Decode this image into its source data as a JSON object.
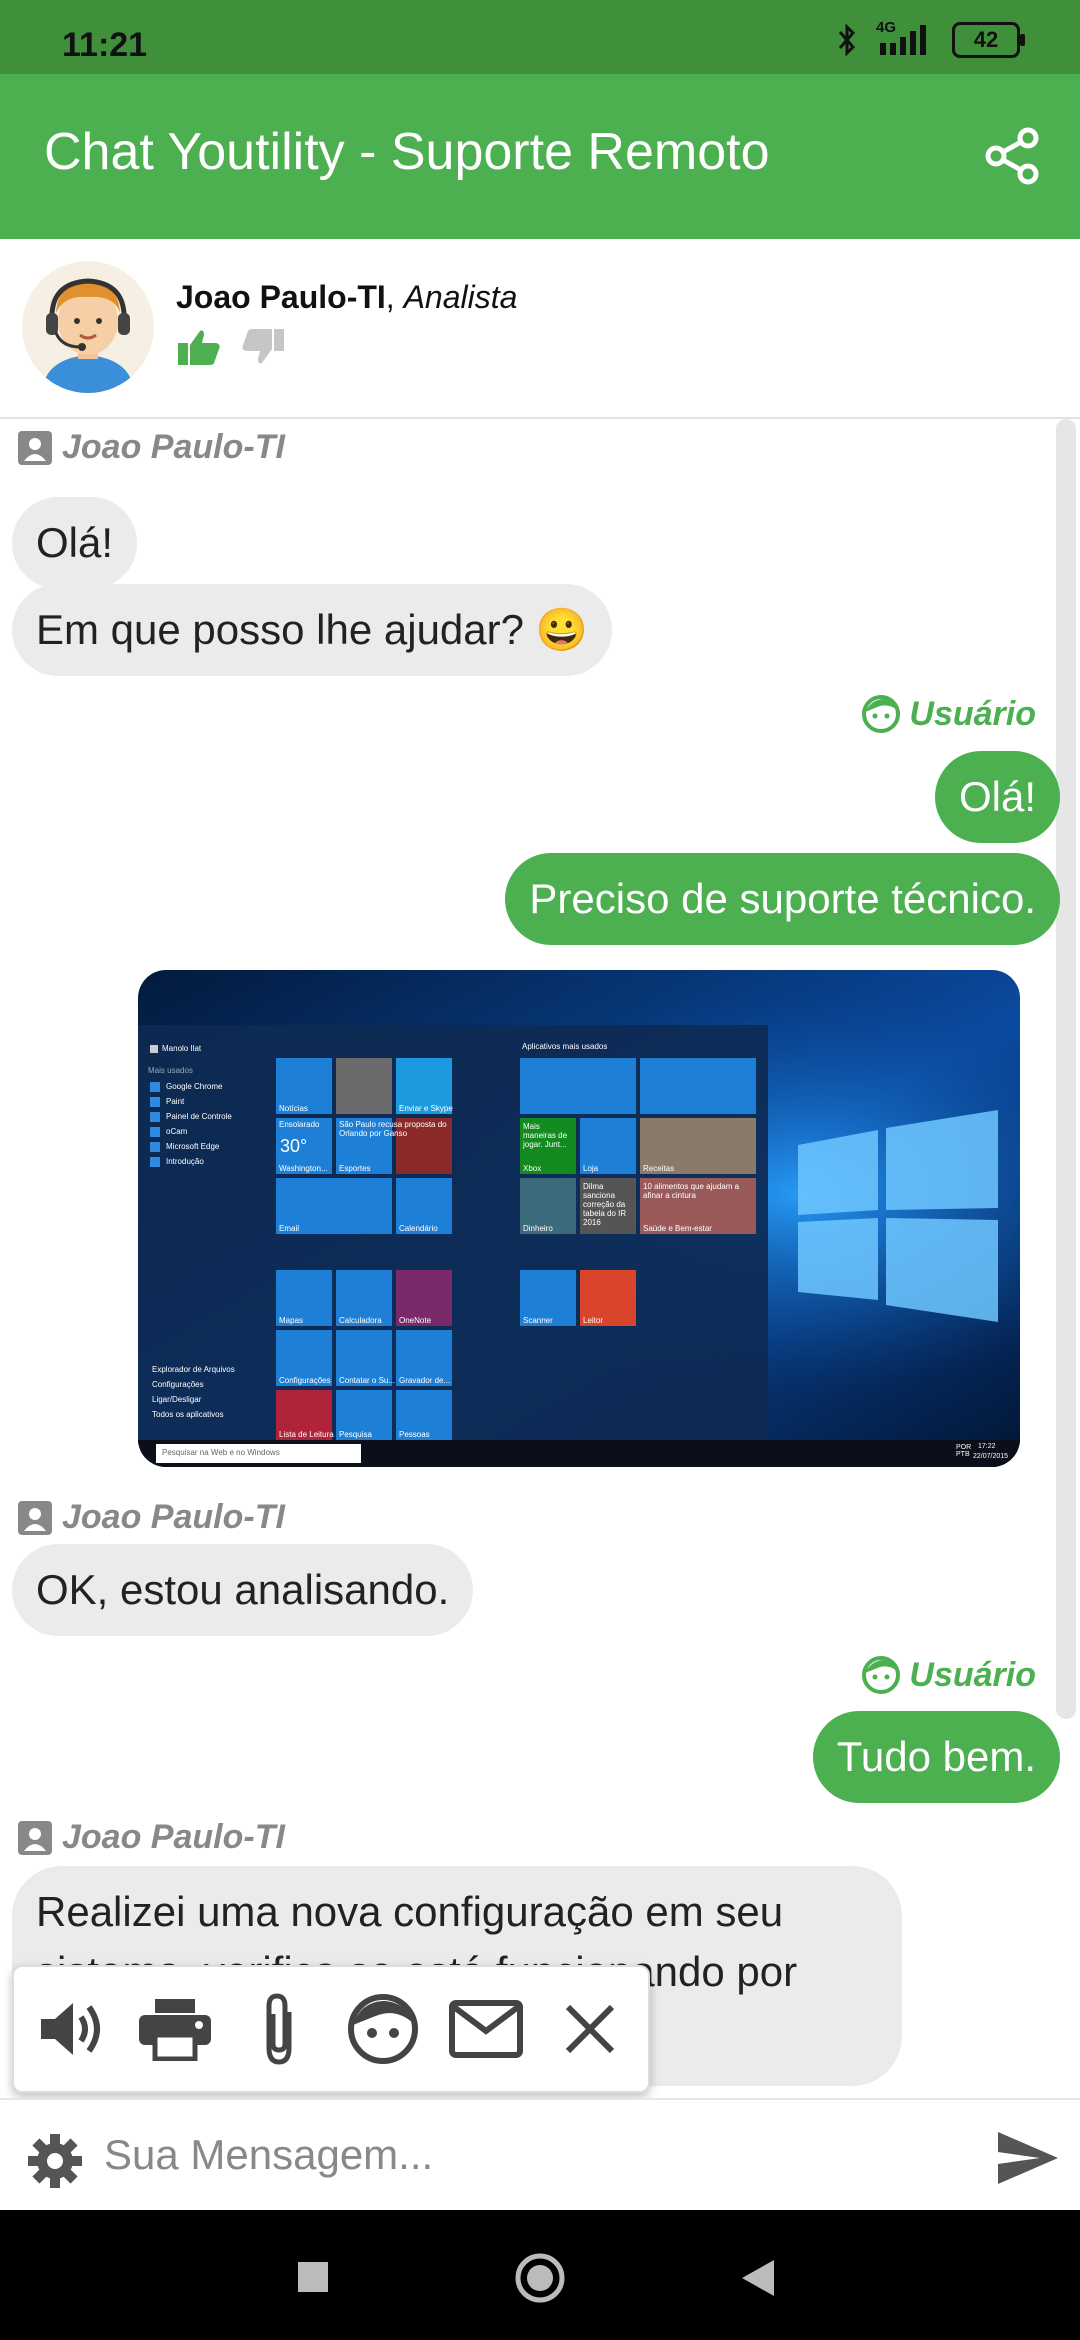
{
  "status_bar": {
    "time": "11:21",
    "network": "4G",
    "battery": "42"
  },
  "app_bar": {
    "title": "Chat Youtility - Suporte Remoto",
    "share_icon": "share-icon"
  },
  "agent": {
    "name": "Joao Paulo-TI",
    "separator": ", ",
    "role": "Analista",
    "like_icon": "thumbs-up-icon",
    "dislike_icon": "thumbs-down-icon"
  },
  "messages": {
    "agent_sender_1": "Joao Paulo-TI",
    "agent_msg_1": "Olá!",
    "agent_msg_2": "Em que posso lhe ajudar? 😀",
    "user_sender_1": "Usuário",
    "user_msg_1": "Olá!",
    "user_msg_2": "Preciso de suporte técnico.",
    "agent_sender_2": "Joao Paulo-TI",
    "agent_msg_3": "OK, estou analisando.",
    "user_sender_2": "Usuário",
    "user_msg_3": "Tudo bem.",
    "agent_sender_3": "Joao Paulo-TI",
    "agent_msg_4": "Realizei uma nova configuração em seu sistema, verifica se está funcionando por favor."
  },
  "screenshot": {
    "user_name": "Manolo Ilat",
    "most_used": "Mais usados",
    "apps": [
      "Google Chrome",
      "Paint",
      "Painel de Controle",
      "oCam",
      "Microsoft Edge",
      "Introdução"
    ],
    "bottom_items": [
      "Explorador de Arquivos",
      "Configurações",
      "Ligar/Desligar",
      "Todos os aplicativos"
    ],
    "search_placeholder": "Pesquisar na Web e no Windows",
    "group_title": "Aplicativos mais usados",
    "tiles_a": [
      "Notícias",
      "Enviar e Skype",
      "Ensolarado",
      "Esportes",
      "Email",
      "Calendário"
    ],
    "tile_weather_temp": "30°",
    "tile_weather_city": "Washington...",
    "tile_news_text": "São Paulo recusa proposta do Orlando por Ganso",
    "tiles_b": [
      "Mapas",
      "Calculadora",
      "OneNote",
      "Configurações",
      "Contatar o Su...",
      "Gravador de...",
      "Lista de Leitura",
      "Pesquisa",
      "Pessoas"
    ],
    "tiles_c": [
      "Xbox",
      "Loja",
      "Receitas",
      "Dinheiro",
      "Saúde e Bem-estar",
      "Scanner",
      "Leitor"
    ],
    "tile_xbox_text": "Mais maneiras de jogar. Junt...",
    "tile_money_text": "Dilma sanciona correção da tabela do IR 2016",
    "tile_health_text": "10 alimentos que ajudam a afinar a cintura",
    "tray_lang": "POR PTB",
    "tray_time": "17:22",
    "tray_date": "22/07/2015"
  },
  "toolbar": {
    "icons": [
      "volume-icon",
      "print-icon",
      "attach-icon",
      "user-face-icon",
      "mail-icon",
      "close-icon"
    ]
  },
  "input": {
    "placeholder": "Sua Mensagem...",
    "settings_icon": "gear-icon",
    "send_icon": "send-icon"
  },
  "nav": {
    "icons": [
      "recents-icon",
      "home-icon",
      "back-icon"
    ]
  },
  "colors": {
    "primary": "#4caf50",
    "status_bar": "#3f8f3b",
    "bubble_left": "#ebebeb",
    "sender_gray": "#888888"
  }
}
